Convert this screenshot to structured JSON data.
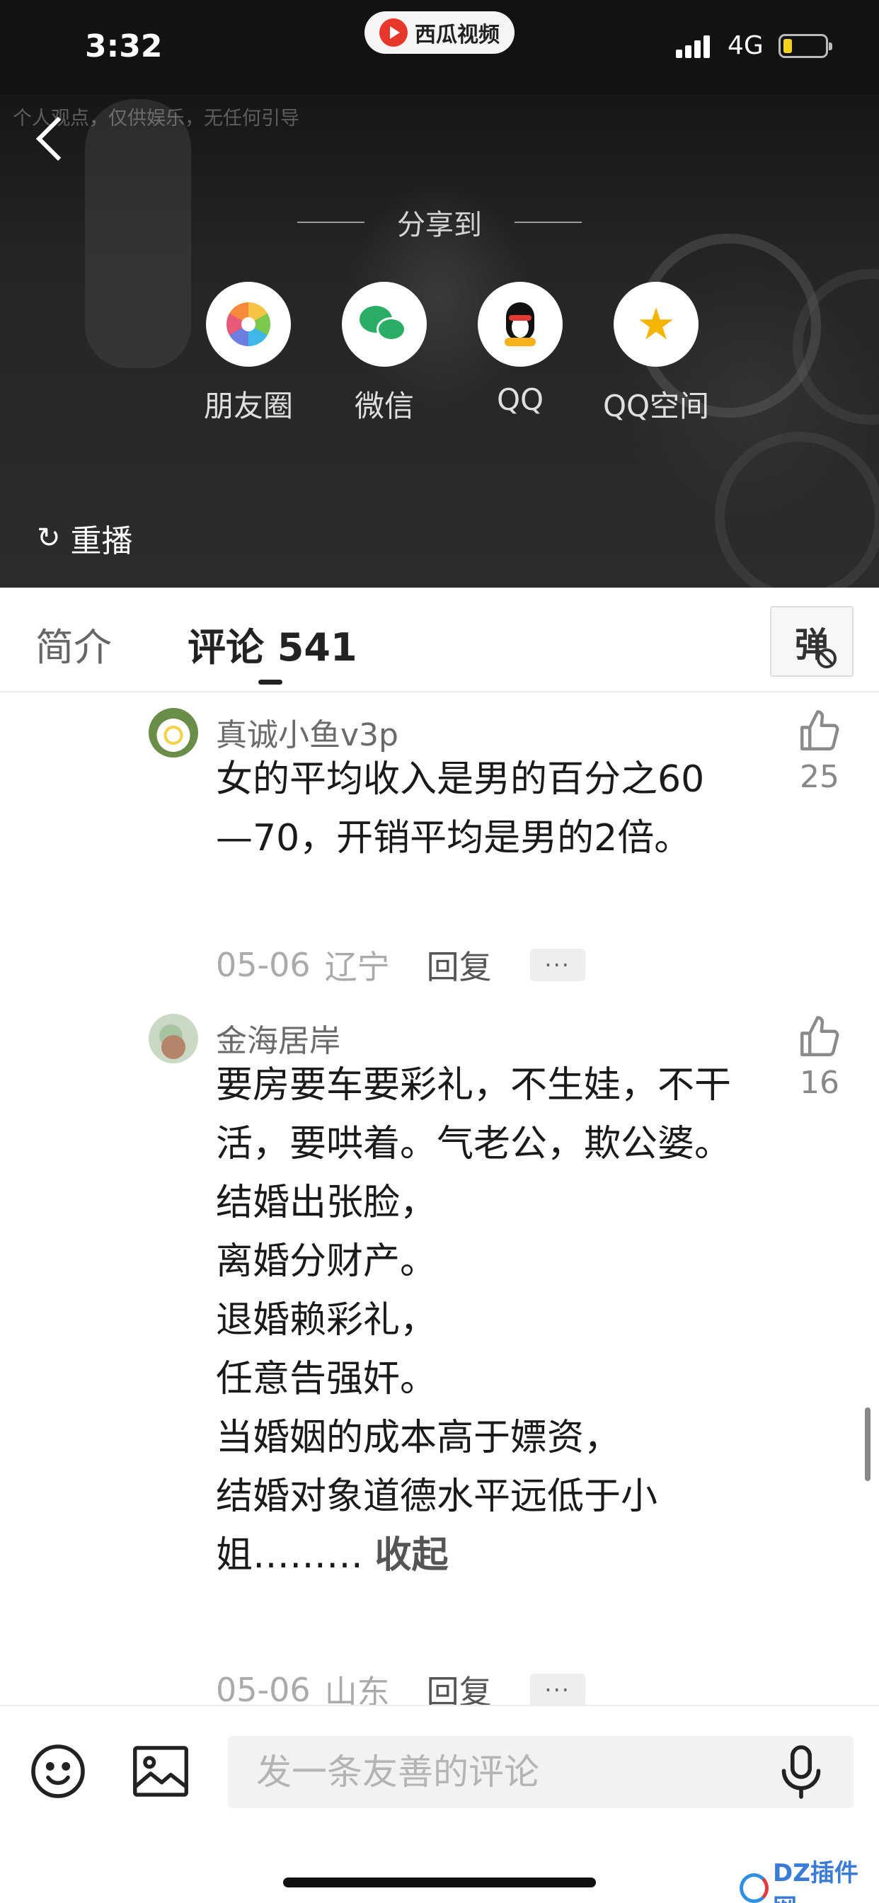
{
  "status_bar": {
    "time": "3:32",
    "app_name": "西瓜视频",
    "network": "4G"
  },
  "video": {
    "disclaimer": "个人观点，仅供娱乐，无任何引导",
    "share_title": "分享到",
    "share_items": [
      {
        "label": "朋友圈",
        "icon": "moments-icon"
      },
      {
        "label": "微信",
        "icon": "wechat-icon"
      },
      {
        "label": "QQ",
        "icon": "qq-icon"
      },
      {
        "label": "QQ空间",
        "icon": "qzone-icon"
      }
    ],
    "replay_label": "重播"
  },
  "tabs": {
    "intro": "简介",
    "comments": "评论 541",
    "danmu": "弹"
  },
  "comments": [
    {
      "username": "真诚小鱼v3p",
      "text": "女的平均收入是男的百分之60—70，开销平均是男的2倍。",
      "date": "05-06",
      "location": "辽宁",
      "reply": "回复",
      "more": "···",
      "likes": "25"
    },
    {
      "username": "金海居岸",
      "text": "要房要车要彩礼，不生娃，不干活，要哄着。气老公，欺公婆。\n结婚出张脸，\n离婚分财产。\n退婚赖彩礼，\n任意告强奸。\n当婚姻的成本高于嫖资，\n结婚对象道德水平远低于小姐………",
      "collapse": "收起",
      "date": "05-06",
      "location": "山东",
      "reply": "回复",
      "more": "···",
      "likes": "16"
    }
  ],
  "bottom_bar": {
    "input_placeholder": "发一条友善的评论"
  },
  "watermark": {
    "text": "DZ插件网"
  },
  "colors": {
    "app_red": "#e8362b",
    "wechat_green": "#2aae67",
    "qzone_yellow": "#f5b400",
    "battery_yellow": "#f2d21b"
  }
}
